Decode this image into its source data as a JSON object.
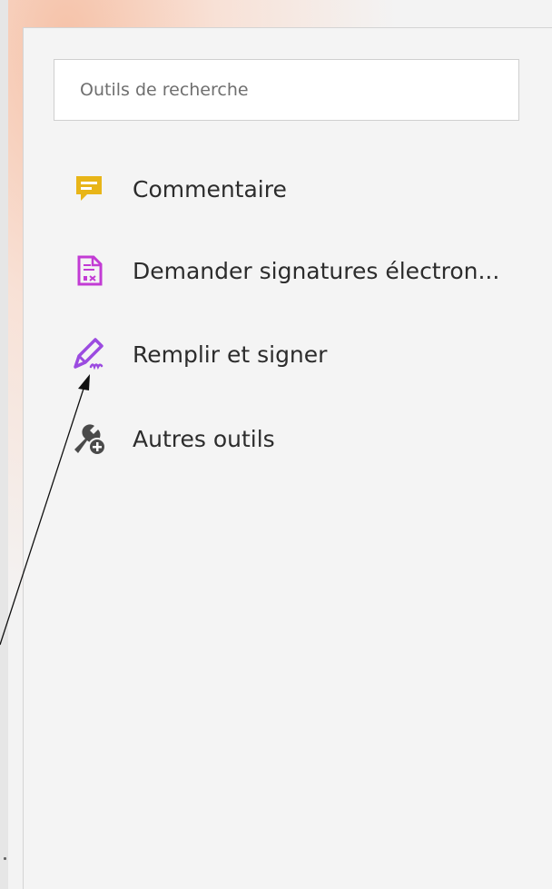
{
  "search": {
    "placeholder": "Outils de recherche"
  },
  "tools": [
    {
      "label": "Commentaire",
      "icon": "comment-icon",
      "color": "#e8b518"
    },
    {
      "label": "Demander signatures électron...",
      "icon": "signature-request-icon",
      "color": "#c23bd4"
    },
    {
      "label": "Remplir et signer",
      "icon": "fill-sign-pen-icon",
      "color": "#9b4be0"
    },
    {
      "label": "Autres outils",
      "icon": "more-tools-icon",
      "color": "#4a4a4a"
    }
  ]
}
